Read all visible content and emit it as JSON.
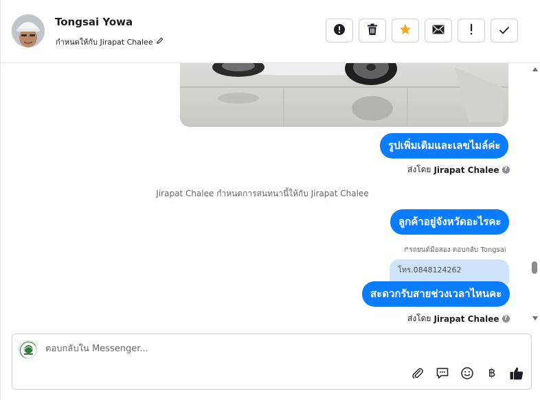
{
  "header": {
    "contact_name": "Tongsai Yowa",
    "assigned_text": "กำหนดให้กับ Jirapat Chalee",
    "actions": [
      {
        "name": "mark-spam-button",
        "icon": "alert-circle-icon"
      },
      {
        "name": "delete-button",
        "icon": "trash-icon"
      },
      {
        "name": "star-button",
        "icon": "star-icon"
      },
      {
        "name": "mark-unread-button",
        "icon": "envelope-icon"
      },
      {
        "name": "follow-up-button",
        "icon": "exclamation-icon"
      },
      {
        "name": "mark-done-button",
        "icon": "check-icon"
      }
    ],
    "star_color": "#f5a623"
  },
  "messages": {
    "bubble1": "รูปเพิ่มเติมและเลขไมล์ค่ะ",
    "sent_by_prefix": "ส่งโดย",
    "sent_by_name": "Jirapat Chalee",
    "system_note": "Jirapat Chalee กำหนดการสนทนานี้ให้กับ Jirapat Chalee",
    "bubble2": "ลูกค้าอยู่จังหวัดอะไรคะ",
    "reply_hint": "รถยนต์มือสอง ตอบกลับ Tongsai",
    "quoted_text": "โทร.0848124262",
    "bubble3": "สะดวกรับสายช่วงเวลาไหนคะ",
    "help_glyph": "?"
  },
  "composer": {
    "placeholder": "ตอบกลับใน Messenger...",
    "tools": [
      "paperclip-icon",
      "saved-reply-icon",
      "emoji-icon",
      "baht-icon",
      "thumbs-up-icon"
    ],
    "baht_symbol": "฿"
  },
  "colors": {
    "accent": "#0a7cff",
    "quoted_bg": "#cfe3fb"
  }
}
